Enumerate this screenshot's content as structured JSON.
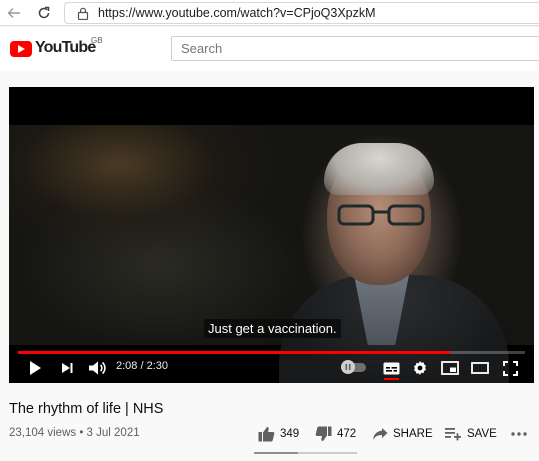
{
  "browser": {
    "url": "https://www.youtube.com/watch?v=CPjoQ3XpzkM",
    "icons": [
      "back-arrow-icon",
      "refresh-icon",
      "lock-icon"
    ]
  },
  "header": {
    "logo_text": "YouTube",
    "region": "GB",
    "search_placeholder": "Search",
    "colors": {
      "brand_red": "#ff0000"
    }
  },
  "player": {
    "caption": "Just get a vaccination.",
    "time": "2:08 / 2:30",
    "progress_fraction": 0.853,
    "controls": [
      "play-icon",
      "next-icon",
      "volume-icon",
      "autoplay-toggle",
      "subtitles-icon",
      "settings-icon",
      "miniplayer-icon",
      "theater-icon",
      "fullscreen-icon"
    ]
  },
  "video": {
    "title": "The rhythm of life | NHS",
    "meta": "23,104 views • 3 Jul 2021",
    "likes": "349",
    "dislikes": "472",
    "share_label": "SHARE",
    "save_label": "SAVE",
    "like_fraction": 0.425
  }
}
